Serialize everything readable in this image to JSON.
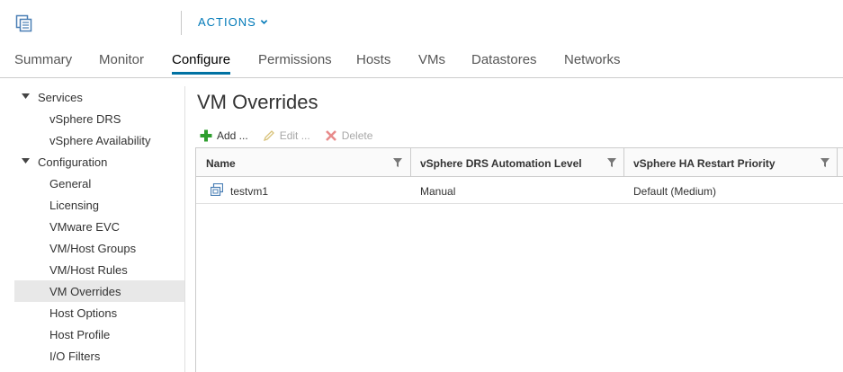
{
  "header": {
    "actions_label": "ACTIONS",
    "icons": {
      "object": "cluster-icon",
      "actions": "chevron-down-icon"
    }
  },
  "tabs": [
    {
      "label": "Summary"
    },
    {
      "label": "Monitor"
    },
    {
      "label": "Configure",
      "active": true
    },
    {
      "label": "Permissions"
    },
    {
      "label": "Hosts"
    },
    {
      "label": "VMs"
    },
    {
      "label": "Datastores"
    },
    {
      "label": "Networks"
    }
  ],
  "sidebar": {
    "groups": [
      {
        "label": "Services",
        "expanded": true,
        "items": [
          "vSphere DRS",
          "vSphere Availability"
        ]
      },
      {
        "label": "Configuration",
        "expanded": true,
        "items": [
          "General",
          "Licensing",
          "VMware EVC",
          "VM/Host Groups",
          "VM/Host Rules",
          "VM Overrides",
          "Host Options",
          "Host Profile",
          "I/O Filters"
        ]
      }
    ],
    "selected": "VM Overrides"
  },
  "main": {
    "title": "VM Overrides",
    "toolbar": {
      "add_label": "Add ...",
      "edit_label": "Edit ...",
      "delete_label": "Delete",
      "edit_enabled": false,
      "delete_enabled": false
    },
    "grid": {
      "columns": [
        "Name",
        "vSphere DRS Automation Level",
        "vSphere HA Restart Priority"
      ],
      "rows": [
        [
          "testvm1",
          "Manual",
          "Default (Medium)"
        ]
      ]
    }
  },
  "colors": {
    "accent": "#0079b8",
    "tab_underline": "#0072a3",
    "selected_bg": "#e8e8e8",
    "add_green": "#2e9e2e",
    "delete_red": "#e05858",
    "disabled_text": "#a8a8a8"
  }
}
